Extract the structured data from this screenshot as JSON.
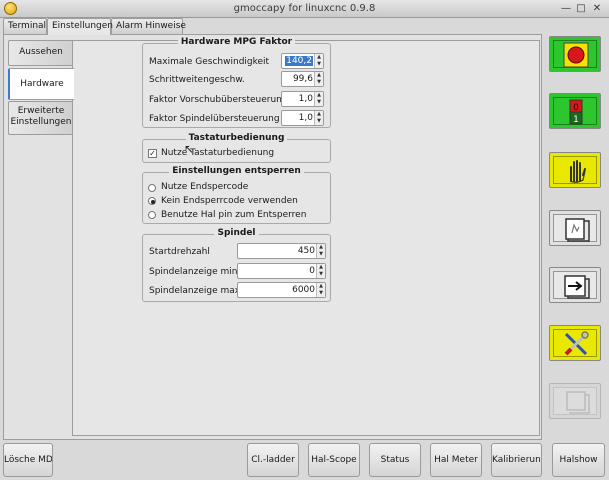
{
  "window": {
    "title": "gmoccapy for linuxcnc 0.9.8"
  },
  "tabs": [
    {
      "label": "Terminal"
    },
    {
      "label": "Einstellungen"
    },
    {
      "label": "Alarm Hinweise"
    }
  ],
  "vtabs": [
    {
      "label": "Aussehen"
    },
    {
      "label": "Hardware"
    },
    {
      "label": "Erweiterte Einstellungen"
    }
  ],
  "mpg": {
    "title": "Hardware MPG Faktor",
    "rows": [
      {
        "label": "Maximale Geschwindigkeit",
        "value": "140,2"
      },
      {
        "label": "Schrittweitengeschw.",
        "value": "99,6"
      },
      {
        "label": "Faktor Vorschubübersteuerung",
        "value": "1,0"
      },
      {
        "label": "Faktor Spindelübersteuerung",
        "value": "1,0"
      }
    ]
  },
  "keyboard": {
    "title": "Tastaturbedienung",
    "checkbox_label": "Nutze Tastaturbedienung",
    "checked": true
  },
  "unlock": {
    "title": "Einstellungen entsperren",
    "options": [
      {
        "label": "Nutze Endspercode",
        "selected": false
      },
      {
        "label": "Kein Endsperrcode verwenden",
        "selected": true
      },
      {
        "label": "Benutze Hal pin zum Entsperren",
        "selected": false
      }
    ]
  },
  "spindle": {
    "title": "Spindel",
    "rows": [
      {
        "label": "Startdrehzahl",
        "value": "450"
      },
      {
        "label": "Spindelanzeige min.",
        "value": "0"
      },
      {
        "label": "Spindelanzeige max.",
        "value": "6000"
      }
    ]
  },
  "side_buttons": [
    {
      "name": "estop-button",
      "icon": "emergency-stop-icon",
      "bg": "#2ec62e"
    },
    {
      "name": "machine-power-button",
      "icon": "power-switch-icon",
      "bg": "#2ec62e"
    },
    {
      "name": "manual-mode-button",
      "icon": "hand-icon",
      "bg": "#e8e800"
    },
    {
      "name": "mdi-mode-button",
      "icon": "mdi-icon",
      "bg": "#e0e0e0"
    },
    {
      "name": "auto-mode-button",
      "icon": "arrow-right-icon",
      "bg": "#e0e0e0"
    },
    {
      "name": "settings-mode-button",
      "icon": "tools-icon",
      "bg": "#e8e800"
    },
    {
      "name": "disabled-button",
      "icon": "disabled-icon",
      "bg": "#d6d6d6"
    }
  ],
  "bottom_buttons": [
    {
      "label": "Lösche MDI"
    },
    {
      "label": "Cl.-ladder"
    },
    {
      "label": "Hal-Scope"
    },
    {
      "label": "Status"
    },
    {
      "label": "Hal Meter"
    },
    {
      "label": "Kalibrierung"
    },
    {
      "label": "Halshow"
    }
  ]
}
